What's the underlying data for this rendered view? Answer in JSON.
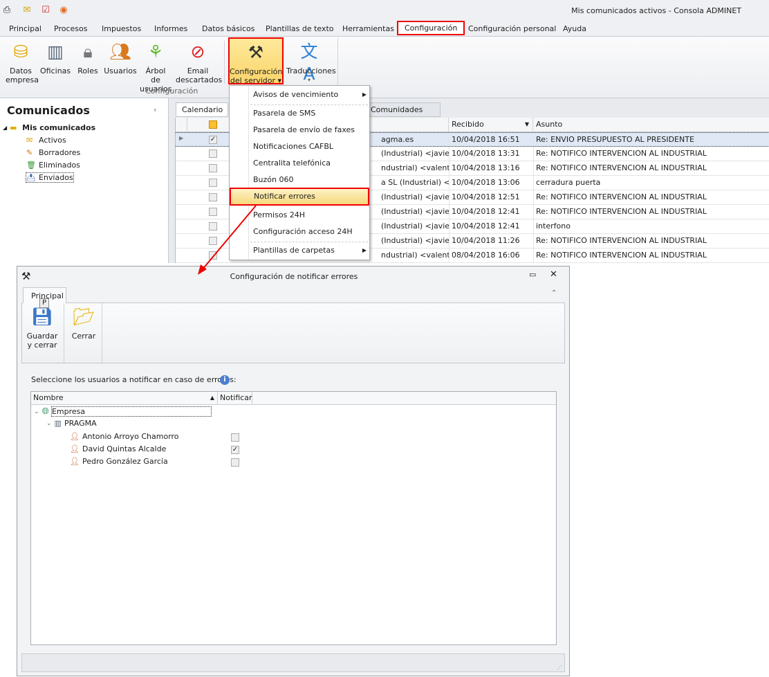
{
  "app": {
    "title": "Mis comunicados activos - Consola ADMINET"
  },
  "menu_tabs": [
    "Principal",
    "Procesos",
    "Impuestos",
    "Informes",
    "Datos básicos",
    "Plantillas de texto",
    "Herramientas",
    "Configuración",
    "Configuración personal",
    "Ayuda"
  ],
  "ribbon": {
    "buttons": [
      {
        "l1": "Datos",
        "l2": "empresa"
      },
      {
        "l1": "Oficinas",
        "l2": ""
      },
      {
        "l1": "Roles",
        "l2": ""
      },
      {
        "l1": "Usuarios",
        "l2": ""
      },
      {
        "l1": "Árbol de",
        "l2": "usuarios"
      },
      {
        "l1": "Email",
        "l2": "descartados"
      },
      {
        "l1": "Configuración",
        "l2": "del servidor ▾"
      },
      {
        "l1": "Traducciones",
        "l2": "▾"
      }
    ],
    "group_label": "Configuración"
  },
  "left": {
    "title": "Comunicados",
    "root": "Mis comunicados",
    "items": [
      "Activos",
      "Borradores",
      "Eliminados",
      "Enviados"
    ]
  },
  "grid": {
    "tabs": [
      "Calendario",
      "Comunidades"
    ],
    "headers": {
      "received": "Recibido",
      "subject": "Asunto"
    },
    "rows": [
      {
        "from": "agma.es",
        "received": "10/04/2018 16:51",
        "subject": "Re: ENVIO PRESUPUESTO AL PRESIDENTE",
        "checked": true
      },
      {
        "from": "(Industrial) <javier.m…",
        "received": "10/04/2018 13:31",
        "subject": "Re: NOTIFICO INTERVENCION AL INDUSTRIAL",
        "checked": false
      },
      {
        "from": "ndustrial) <valentin.…",
        "received": "10/04/2018 13:16",
        "subject": "Re: NOTIFICO INTERVENCION AL INDUSTRIAL",
        "checked": false
      },
      {
        "from": "a SL (Industrial) <cer…",
        "received": "10/04/2018 13:06",
        "subject": "cerradura puerta",
        "checked": false
      },
      {
        "from": "(Industrial) <javier.m…",
        "received": "10/04/2018 12:51",
        "subject": "Re: NOTIFICO INTERVENCION AL INDUSTRIAL",
        "checked": false
      },
      {
        "from": "(Industrial) <javier.m…",
        "received": "10/04/2018 12:41",
        "subject": "Re: NOTIFICO INTERVENCION AL INDUSTRIAL",
        "checked": false
      },
      {
        "from": "(Industrial) <javier.m…",
        "received": "10/04/2018 12:41",
        "subject": "interfono",
        "checked": false
      },
      {
        "from": "(Industrial) <javier.m…",
        "received": "10/04/2018 11:26",
        "subject": "Re: NOTIFICO INTERVENCION AL INDUSTRIAL",
        "checked": false
      },
      {
        "from": "ndustrial) <valentin.…",
        "received": "08/04/2018 16:06",
        "subject": "Re: NOTIFICO INTERVENCION AL INDUSTRIAL",
        "checked": false
      }
    ]
  },
  "dropdown": {
    "items": [
      "Avisos de vencimiento",
      "Pasarela de SMS",
      "Pasarela de envío de faxes",
      "Notificaciones CAFBL",
      "Centralita telefónica",
      "Buzón 060",
      "Notificar errores",
      "Permisos 24H",
      "Configuración acceso 24H",
      "Plantillas de carpetas"
    ]
  },
  "dialog": {
    "title": "Configuración de notificar errores",
    "tab": "Principal",
    "key_tip": "P",
    "save": {
      "l1": "Guardar",
      "l2": "y cerrar"
    },
    "close": "Cerrar",
    "instruction": "Seleccione los usuarios a notificar en caso de errores:",
    "col_name": "Nombre",
    "col_notify": "Notificar",
    "company": "Empresa",
    "office": "PRAGMA",
    "users": [
      {
        "name": "Antonio Arroyo Chamorro",
        "notify": false
      },
      {
        "name": "David Quintas Alcalde",
        "notify": true
      },
      {
        "name": "Pedro González García",
        "notify": false
      }
    ]
  },
  "colors": {
    "highlight": "#e00000",
    "accent": "#fbd56b"
  }
}
